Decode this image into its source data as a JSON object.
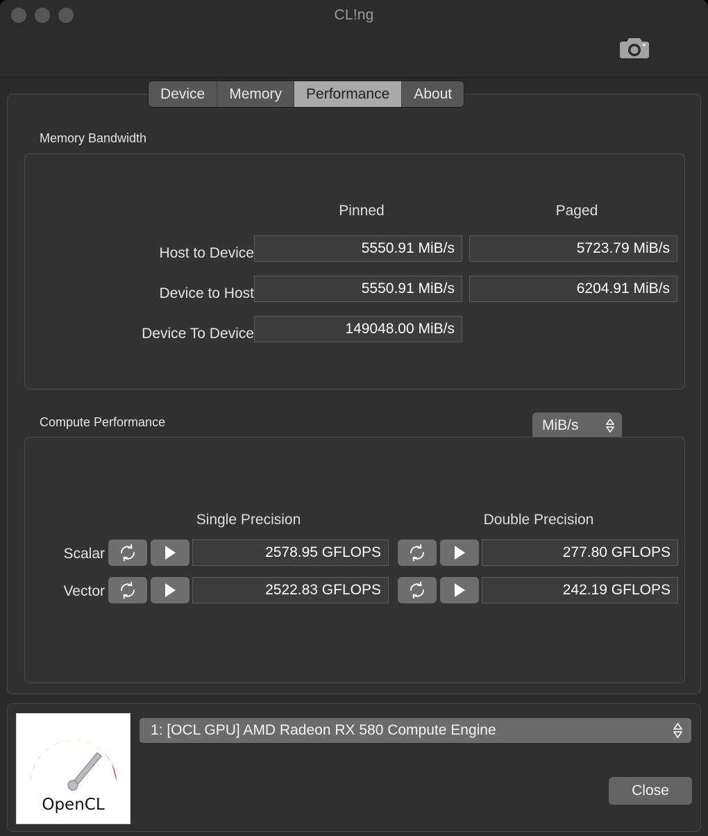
{
  "window": {
    "title": "CL!ng",
    "traffic_lights": [
      "close-button",
      "minimize-button",
      "zoom-button"
    ],
    "camera_icon": "camera-icon"
  },
  "tabs": [
    {
      "label": "Device",
      "selected": false
    },
    {
      "label": "Memory",
      "selected": false
    },
    {
      "label": "Performance",
      "selected": true
    },
    {
      "label": "About",
      "selected": false
    }
  ],
  "memory_bandwidth": {
    "group_label": "Memory Bandwidth",
    "columns": [
      "Pinned",
      "Paged"
    ],
    "rows": [
      {
        "label": "Host to Device",
        "pinned": "5550.91 MiB/s",
        "paged": "5723.79 MiB/s"
      },
      {
        "label": "Device to Host",
        "pinned": "5550.91 MiB/s",
        "paged": "6204.91 MiB/s"
      },
      {
        "label": "Device To Device",
        "pinned": "149048.00 MiB/s",
        "paged": null
      }
    ],
    "unit_selector": {
      "value": "MiB/s",
      "icon": "chevron-up-down-icon"
    }
  },
  "compute_performance": {
    "group_label": "Compute Performance",
    "columns": [
      "Single Precision",
      "Double Precision"
    ],
    "rows": [
      {
        "label": "Scalar",
        "single": "2578.95 GFLOPS",
        "double": "277.80 GFLOPS",
        "refresh_icon": "refresh-icon",
        "run_icon": "play-icon"
      },
      {
        "label": "Vector",
        "single": "2522.83 GFLOPS",
        "double": "242.19 GFLOPS",
        "refresh_icon": "refresh-icon",
        "run_icon": "play-icon"
      }
    ]
  },
  "bottom_bar": {
    "logo": {
      "text": "OpenCL",
      "icon": "gauge-icon",
      "arc_colors": [
        "#3aa03a",
        "#55b02c",
        "#8cc12a",
        "#c7d12a",
        "#f2c21a",
        "#f79a13",
        "#ef5a16",
        "#e8301a"
      ]
    },
    "device_selector": {
      "value": "1: [OCL GPU] AMD Radeon RX 580 Compute Engine",
      "icon": "chevron-up-down-icon"
    },
    "close_button": "Close"
  },
  "colors": {
    "window_bg": "#2b2b2b",
    "panel_bg": "#303030",
    "group_bg": "#333333",
    "field_bg": "#3c3c3c",
    "selected_tab": "#a9a9a9",
    "tab_bg": "#565656",
    "text": "#e4e4e4"
  }
}
